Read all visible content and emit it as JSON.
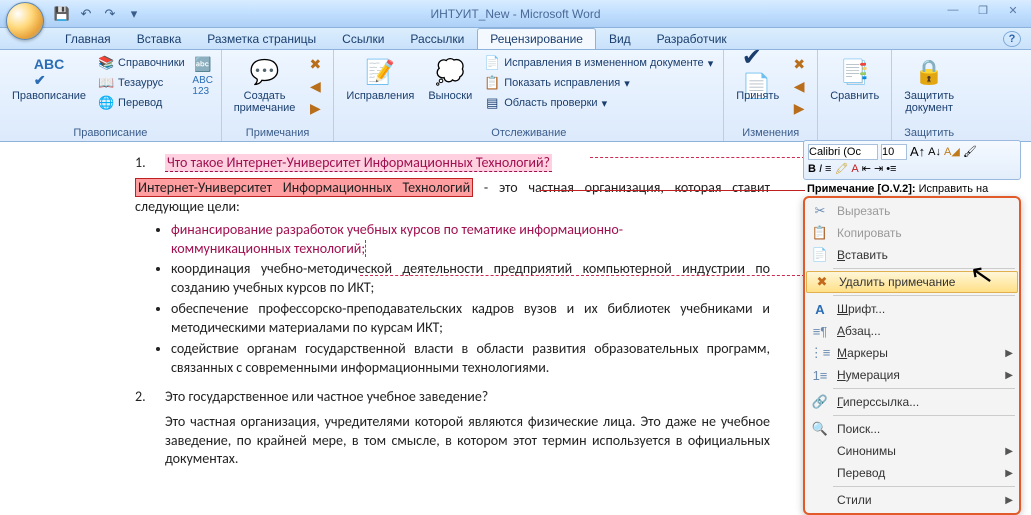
{
  "app": {
    "title": "ИНТУИТ_New - Microsoft Word"
  },
  "qat": {
    "save": "💾",
    "undo": "↶",
    "redo": "↷",
    "dd": "▾"
  },
  "win": {
    "min": "—",
    "max": "❐",
    "close": "✕"
  },
  "tabs": {
    "home": "Главная",
    "insert": "Вставка",
    "pagelayout": "Разметка страницы",
    "refs": "Ссылки",
    "mail": "Рассылки",
    "review": "Рецензирование",
    "view": "Вид",
    "dev": "Разработчик",
    "help": "?"
  },
  "ribbon": {
    "proofing": {
      "spelling": "Правописание",
      "research": "Справочники",
      "thesaurus": "Тезаурус",
      "translate": "Перевод",
      "label": "Правописание"
    },
    "comments": {
      "new": "Создать\nпримечание",
      "label": "Примечания"
    },
    "tracking": {
      "track": "Исправления",
      "balloons": "Выноски",
      "display": "Исправления в измененном документе",
      "showmarkup": "Показать исправления",
      "reviewpane": "Область проверки",
      "label": "Отслеживание"
    },
    "changes": {
      "accept": "Принять",
      "label": "Изменения"
    },
    "compare": {
      "compare": "Сравнить",
      "label": ""
    },
    "protect": {
      "protect": "Защитить\nдокумент",
      "label": "Защитить"
    }
  },
  "doc": {
    "q1num": "1.",
    "q1": "Что такое Интернет-Университет Информационных Технологий?",
    "a1_hl": "Интернет-Университет Информационных Технологий",
    "a1_rest": " - это частная организация, которая ставит следующие цели:",
    "b1a": "финансирование разработок учебных курсов по тематике информационно-",
    "b1b": "коммуникационных технологий;",
    "b2": "координация учебно-методической деятельности предприятий компьютерной индустрии по созданию учебных курсов по ИКТ;",
    "b3": "обеспечение профессорско-преподавательских кадров вузов и их библиотек учебниками и методическими материалами по курсам ИКТ;",
    "b4": "содействие органам государственной власти в области развития образовательных программ, связанных с современными информационными технологиями.",
    "q2num": "2.",
    "q2": "Это государственное или частное учебное заведение?",
    "a2": "Это частная организация, учредителями которой являются физические лица. Это даже не учебное заведение, по крайней мере, в том смысле, в котором этот термин используется в официальных документах."
  },
  "minitb": {
    "font": "Calibri (Ос",
    "size": "10",
    "comment_tag": "Примечание [O.V.2]:",
    "comment_txt": "Исправить на"
  },
  "ctx": {
    "cut": "Вырезать",
    "copy": "Копировать",
    "paste": "Вставить",
    "delcomment": "Удалить примечание",
    "font": "Шрифт...",
    "para": "Абзац...",
    "bullets": "Маркеры",
    "numbering": "Нумерация",
    "hyperlink": "Гиперссылка...",
    "lookup": "Поиск...",
    "synonyms": "Синонимы",
    "translate": "Перевод",
    "styles": "Стили"
  }
}
